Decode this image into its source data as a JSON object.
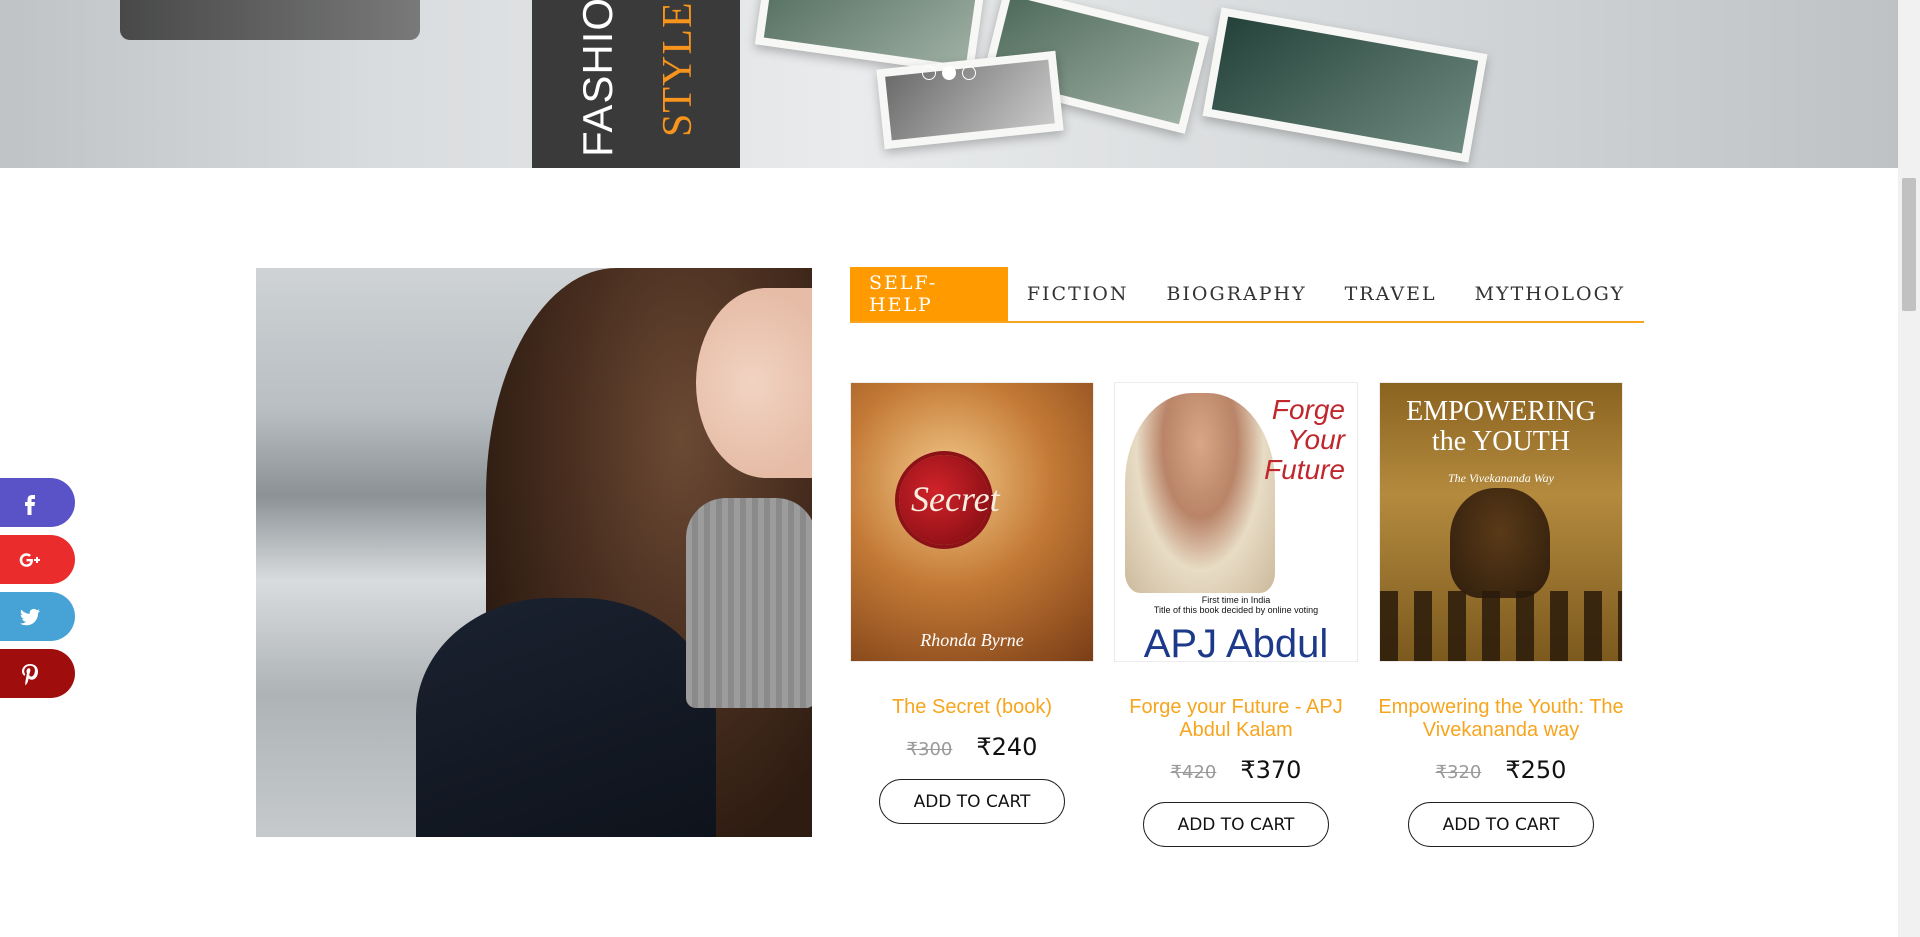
{
  "hero": {
    "banner_line1": "FASHION",
    "banner_line2": "STYLE I",
    "slides": 3,
    "active_slide": 2
  },
  "social": [
    {
      "name": "facebook",
      "color": "#5a53c8"
    },
    {
      "name": "google-plus",
      "color": "#ea2c2c"
    },
    {
      "name": "twitter",
      "color": "#47a3d6"
    },
    {
      "name": "pinterest",
      "color": "#a00d0d"
    }
  ],
  "tabs": [
    {
      "label": "SELF-HELP",
      "active": true
    },
    {
      "label": "FICTION",
      "active": false
    },
    {
      "label": "BIOGRAPHY",
      "active": false
    },
    {
      "label": "TRAVEL",
      "active": false
    },
    {
      "label": "MYTHOLOGY",
      "active": false
    }
  ],
  "products": [
    {
      "title": "The Secret (book)",
      "old_price": "₹300",
      "new_price": "₹240",
      "cart_label": "ADD TO CART",
      "cover": {
        "main": "Secret",
        "author": "Rhonda Byrne"
      }
    },
    {
      "title": "Forge your Future - APJ Abdul Kalam",
      "old_price": "₹420",
      "new_price": "₹370",
      "cart_label": "ADD TO CART",
      "cover": {
        "title1": "Forge",
        "title2": "Your",
        "title3": "Future",
        "tagline1": "First time in India",
        "tagline2": "Title of this book decided by online voting",
        "name": "APJ Abdul"
      }
    },
    {
      "title": "Empowering the Youth: The Vivekananda way",
      "old_price": "₹320",
      "new_price": "₹250",
      "cart_label": "ADD TO CART",
      "cover": {
        "title1": "EMPOWERING",
        "title2": "the YOUTH",
        "subtitle": "The Vivekananda Way"
      }
    }
  ],
  "colors": {
    "accent": "#f7a51e",
    "tab_active": "#ff9a00"
  }
}
